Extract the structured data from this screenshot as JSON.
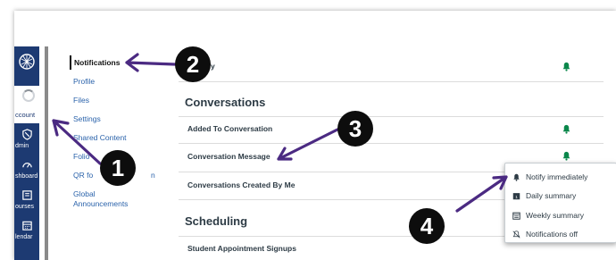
{
  "global_nav": {
    "items": [
      {
        "label": "ccount",
        "icon": "spinner-icon"
      },
      {
        "label": "dmin",
        "icon": "shield-icon"
      },
      {
        "label": "shboard",
        "icon": "dashboard-icon"
      },
      {
        "label": "ourses",
        "icon": "courses-icon"
      },
      {
        "label": "lendar",
        "icon": "calendar-icon"
      }
    ]
  },
  "account_nav": {
    "items": [
      "Notifications",
      "Profile",
      "Files",
      "Settings",
      "Shared Content",
      "Folio",
      "QR fo",
      "n",
      "Global",
      "Announcements"
    ]
  },
  "content": {
    "top_row": "d Reply",
    "section_conversations": "Conversations",
    "rows": [
      "Added To Conversation",
      "Conversation Message",
      "Conversations Created By Me"
    ],
    "section_scheduling": "Scheduling",
    "scheduling_row": "Student Appointment Signups"
  },
  "dropdown": {
    "options": [
      "Notify immediately",
      "Daily summary",
      "Weekly summary",
      "Notifications off"
    ]
  },
  "annotations": [
    "1",
    "2",
    "3",
    "4"
  ],
  "colors": {
    "nav_bg": "#1d3a72",
    "bell": "#0b874b",
    "link": "#2b63ab",
    "arrow": "#4b2a82"
  }
}
